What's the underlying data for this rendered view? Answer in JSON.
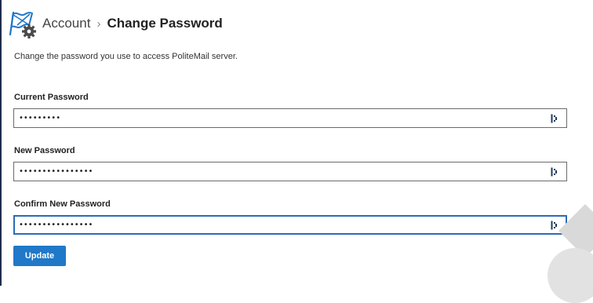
{
  "header": {
    "breadcrumb_parent": "Account",
    "breadcrumb_separator": "›",
    "breadcrumb_current": "Change Password"
  },
  "description": "Change the password you use to access PoliteMail server.",
  "fields": {
    "current_password": {
      "label": "Current Password",
      "value": "•••••••••"
    },
    "new_password": {
      "label": "New Password",
      "value": "••••••••••••••••"
    },
    "confirm_password": {
      "label": "Confirm New Password",
      "value": "••••••••••••••••"
    }
  },
  "update_label": "Update",
  "icons": {
    "logo": "politemail-flag-gear-logo",
    "reveal": "reveal-password-icon"
  },
  "colors": {
    "accent": "#1f78c8",
    "focus_border": "#2b6cb8",
    "logo_blue": "#1f78c8",
    "gear": "#4a4a4a"
  }
}
